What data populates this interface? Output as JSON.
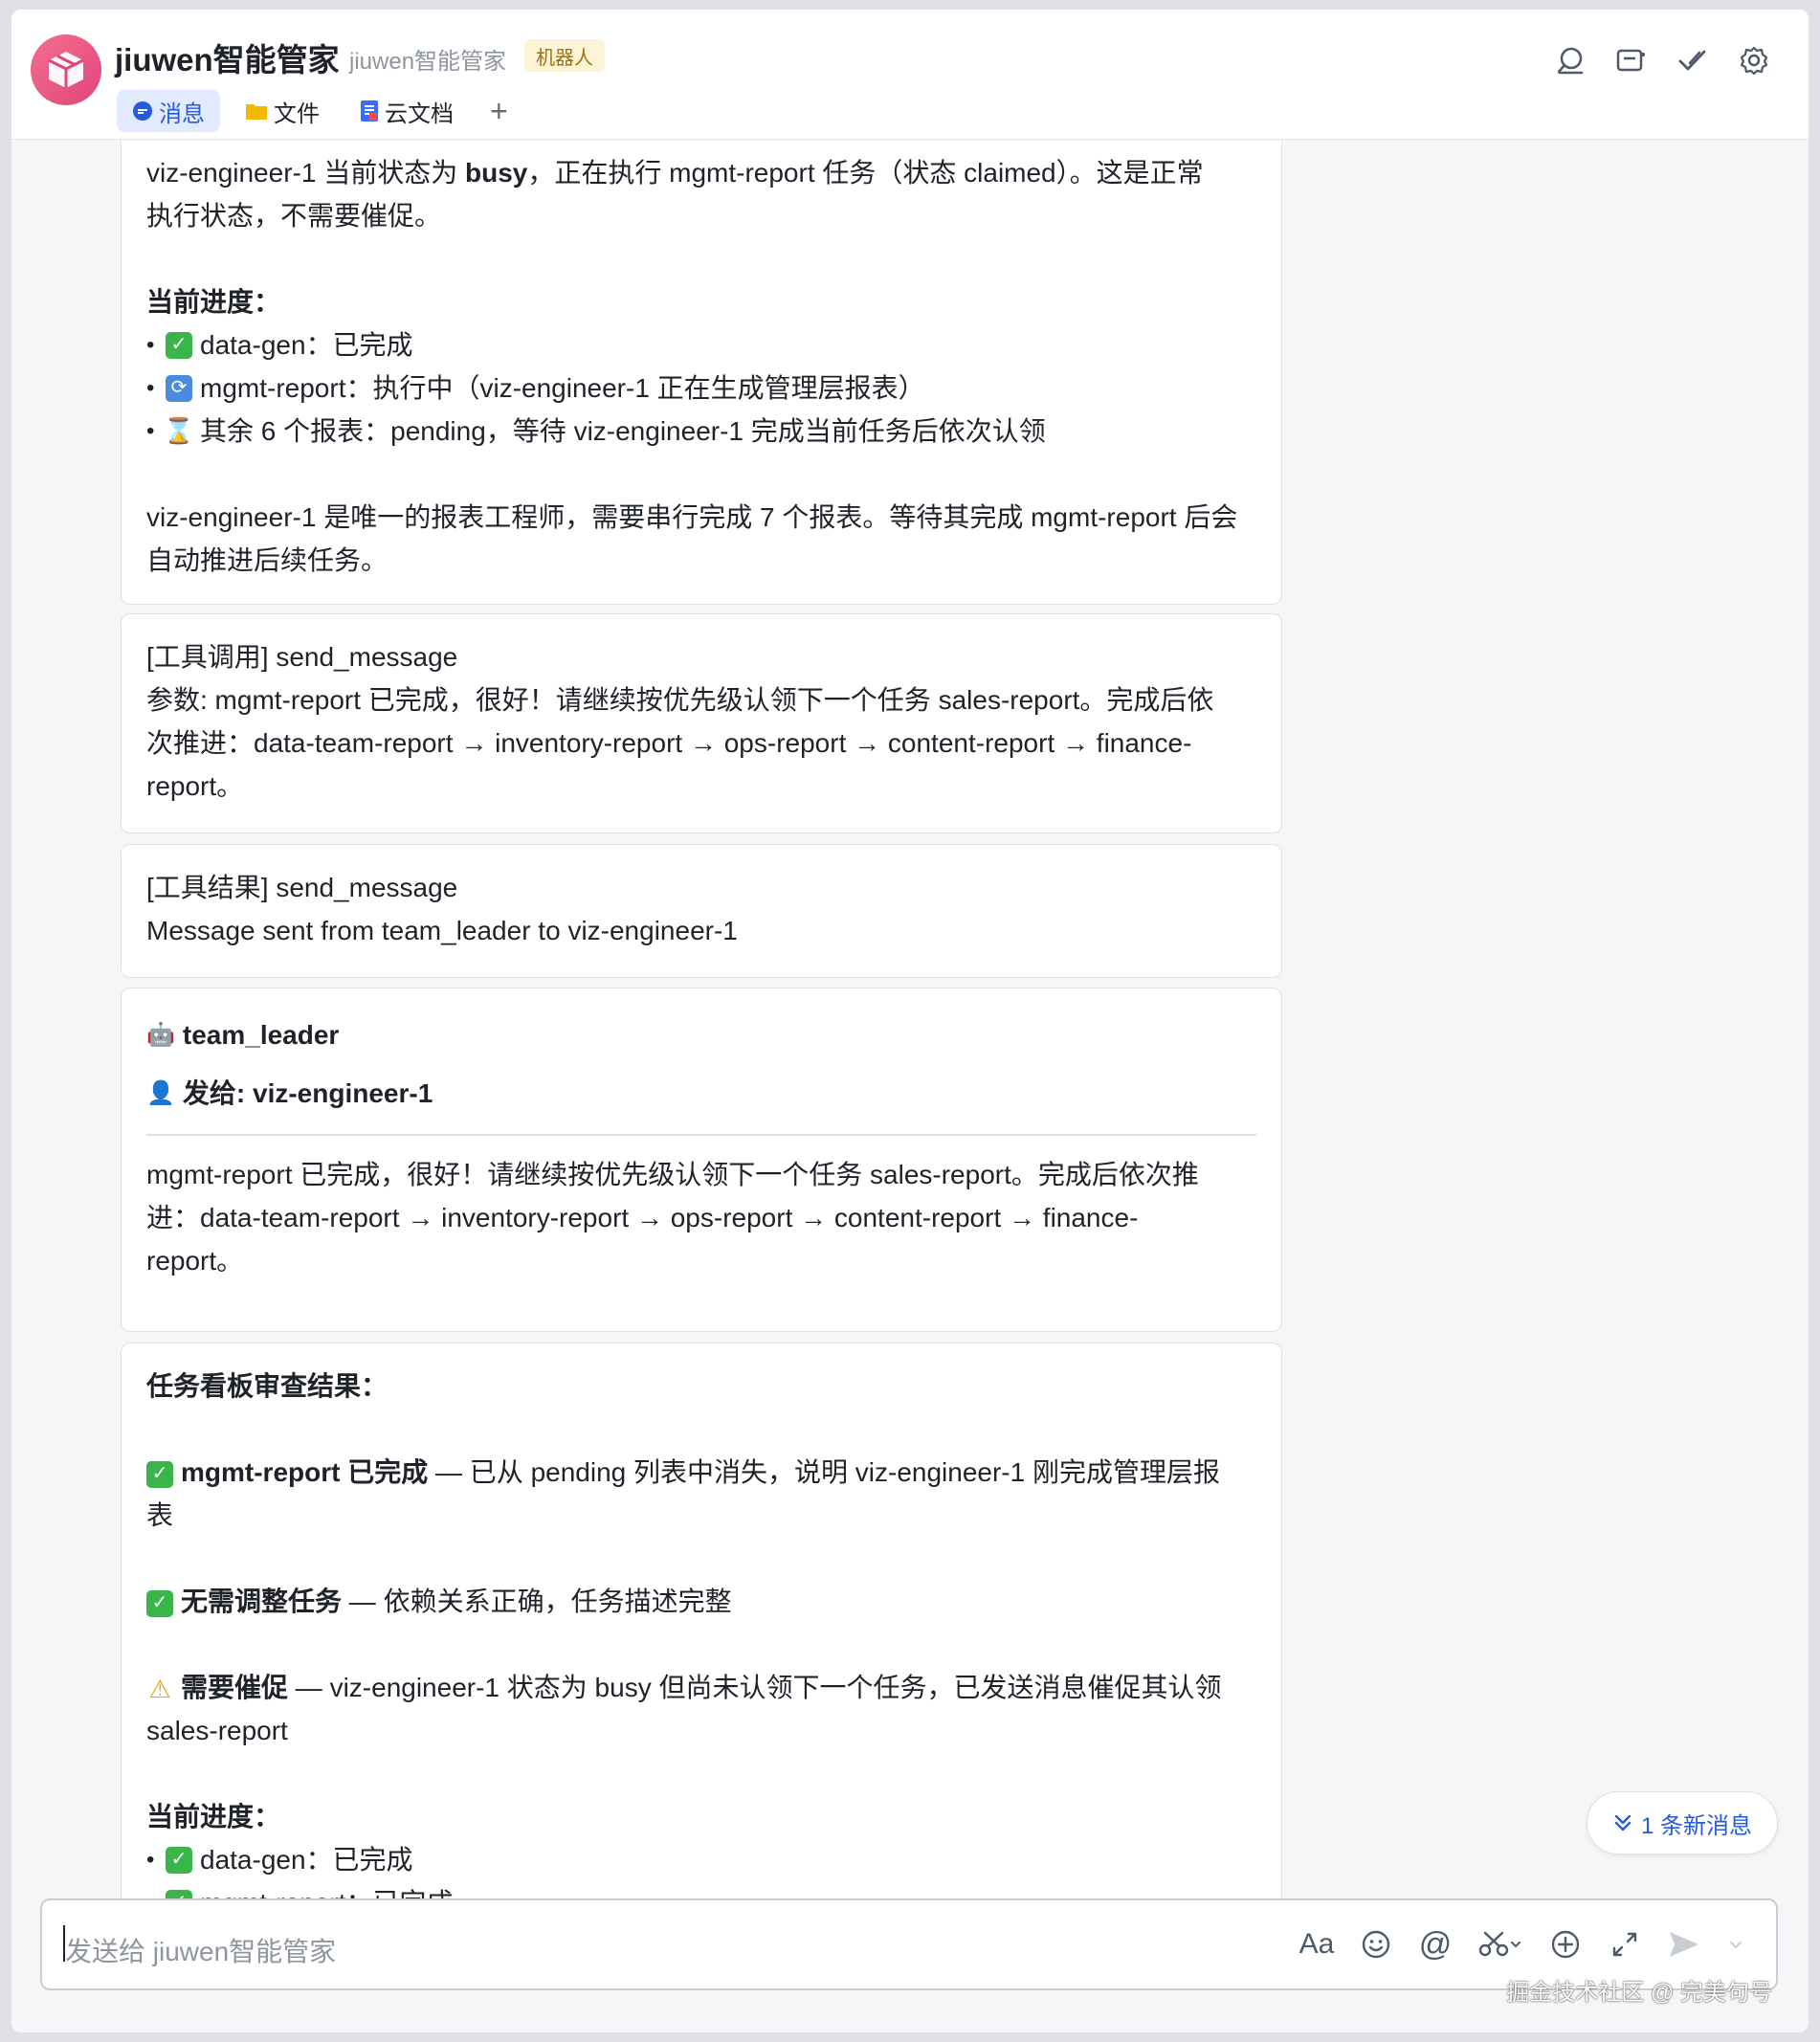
{
  "header": {
    "title": "jiuwen智能管家",
    "subtitle": "jiuwen智能管家",
    "badge": "机器人",
    "tabs": [
      {
        "label": "消息",
        "icon": "chat-bubble-icon"
      },
      {
        "label": "文件",
        "icon": "folder-icon"
      },
      {
        "label": "云文档",
        "icon": "doc-icon"
      }
    ],
    "add_tab": "+"
  },
  "messages": {
    "m1": {
      "line1_a": "viz-engineer-1 当前状态为 ",
      "line1_b": "busy",
      "line1_c": "，正在执行 mgmt-report 任务（状态 claimed）。这是正常",
      "line2": "执行状态，不需要催促。",
      "progress_title": "当前进度：",
      "bullets": [
        "data-gen：已完成",
        "mgmt-report：执行中（viz-engineer-1 正在生成管理层报表）",
        "其余 6 个报表：pending，等待 viz-engineer-1 完成当前任务后依次认领"
      ],
      "footer1": "viz-engineer-1 是唯一的报表工程师，需要串行完成 7 个报表。等待其完成 mgmt-report 后会",
      "footer2": "自动推进后续任务。"
    },
    "m2": {
      "title": "[工具调用] send_message",
      "line1": "参数: mgmt-report 已完成，很好！请继续按优先级认领下一个任务 sales-report。完成后依",
      "line2": "次推进：data-team-report → inventory-report → ops-report → content-report → finance-",
      "line3": "report。"
    },
    "m3": {
      "title": "[工具结果] send_message",
      "line1": "Message sent from team_leader to viz-engineer-1"
    },
    "m4": {
      "sender": "team_leader",
      "to": "发给: viz-engineer-1",
      "line1": "mgmt-report 已完成，很好！请继续按优先级认领下一个任务 sales-report。完成后依次推",
      "line2": "进：data-team-report → inventory-report → ops-report → content-report → finance-",
      "line3": "report。"
    },
    "m5": {
      "title": "任务看板审查结果：",
      "item1_bold": "mgmt-report 已完成",
      "item1_rest": " — 已从 pending 列表中消失，说明 viz-engineer-1 刚完成管理层报",
      "item1_cont": "表",
      "item2_bold": "无需调整任务",
      "item2_rest": " — 依赖关系正确，任务描述完整",
      "item3_bold": "需要催促",
      "item3_rest": " — viz-engineer-1 状态为 busy 但尚未认领下一个任务，已发送消息催促其认领",
      "item3_cont": "sales-report",
      "progress_title": "当前进度：",
      "bullet1": "data-gen：已完成",
      "bullet2_partial": "mgmt-report：已完成"
    }
  },
  "new_message_pill": "1 条新消息",
  "input": {
    "placeholder": "发送给 jiuwen智能管家"
  },
  "watermark": "掘金技术社区 @ 完美句号"
}
